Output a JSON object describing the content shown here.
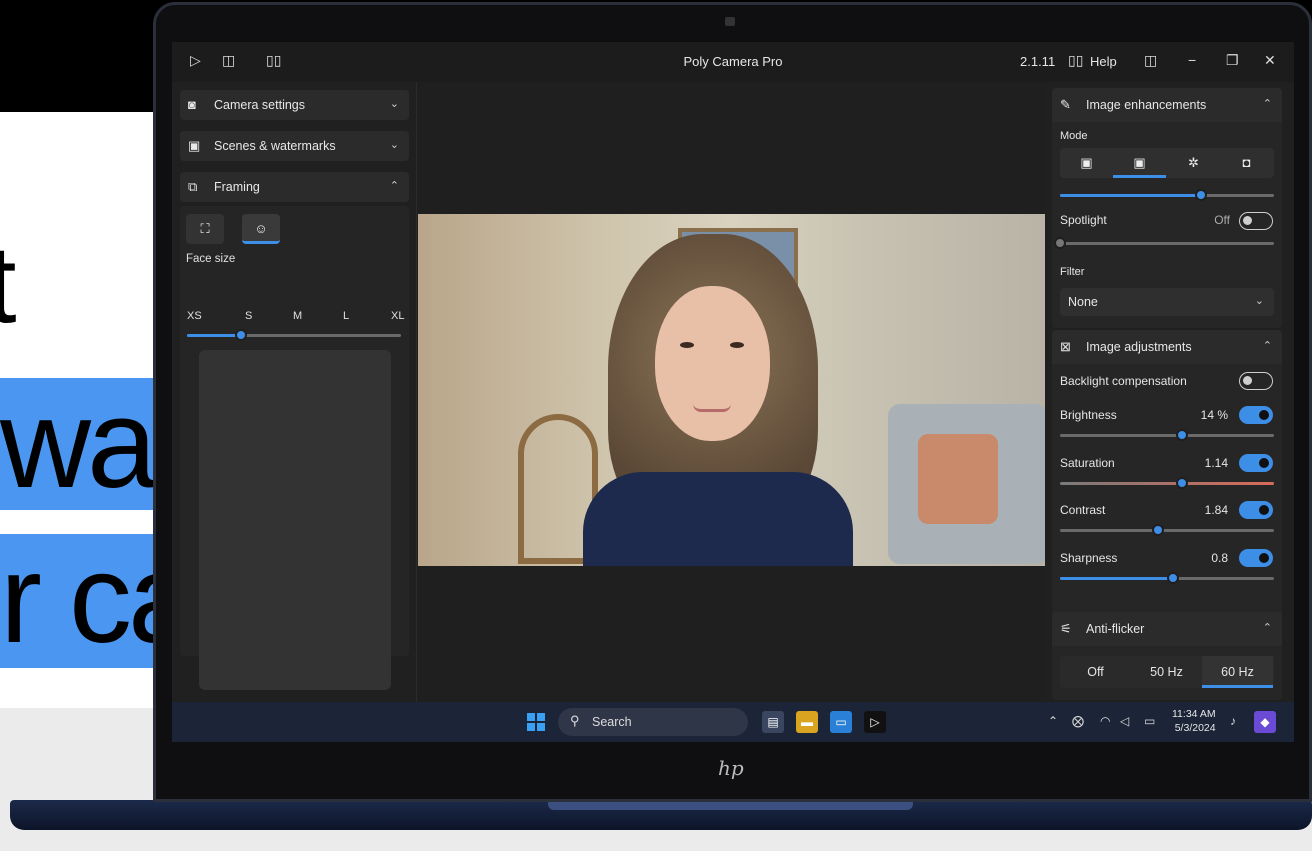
{
  "headline": {
    "fragment_top": "t",
    "line1": "want to",
    "line2": "r camera"
  },
  "hp_logo": "hp",
  "app": {
    "title": "Poly Camera Pro",
    "version": "2.1.11",
    "help_label": "Help"
  },
  "left_panel": {
    "camera_settings": "Camera settings",
    "scenes_watermarks": "Scenes & watermarks",
    "framing": "Framing",
    "face_size_label": "Face size",
    "face_size_ticks": [
      "XS",
      "S",
      "M",
      "L",
      "XL"
    ],
    "face_size_value": "S"
  },
  "image_enhancements": {
    "title": "Image enhancements",
    "mode_label": "Mode",
    "mode_slider_fraction": 0.66,
    "spotlight_label": "Spotlight",
    "spotlight_state": "Off",
    "spotlight_fraction": 0.0,
    "filter_label": "Filter",
    "filter_value": "None"
  },
  "image_adjustments": {
    "title": "Image adjustments",
    "backlight_label": "Backlight compensation",
    "brightness_label": "Brightness",
    "brightness_value": "14 %",
    "brightness_fraction": 0.57,
    "saturation_label": "Saturation",
    "saturation_value": "1.14",
    "saturation_fraction": 0.57,
    "contrast_label": "Contrast",
    "contrast_value": "1.84",
    "contrast_fraction": 0.46,
    "sharpness_label": "Sharpness",
    "sharpness_value": "0.8",
    "sharpness_fraction": 0.53
  },
  "anti_flicker": {
    "title": "Anti-flicker",
    "options": [
      "Off",
      "50 Hz",
      "60 Hz"
    ],
    "selected": "60 Hz"
  },
  "taskbar": {
    "search_placeholder": "Search",
    "time": "11:34 AM",
    "date": "5/3/2024"
  },
  "colors": {
    "accent": "#3d8ee6",
    "headline_highlight": "#4a96f0"
  }
}
